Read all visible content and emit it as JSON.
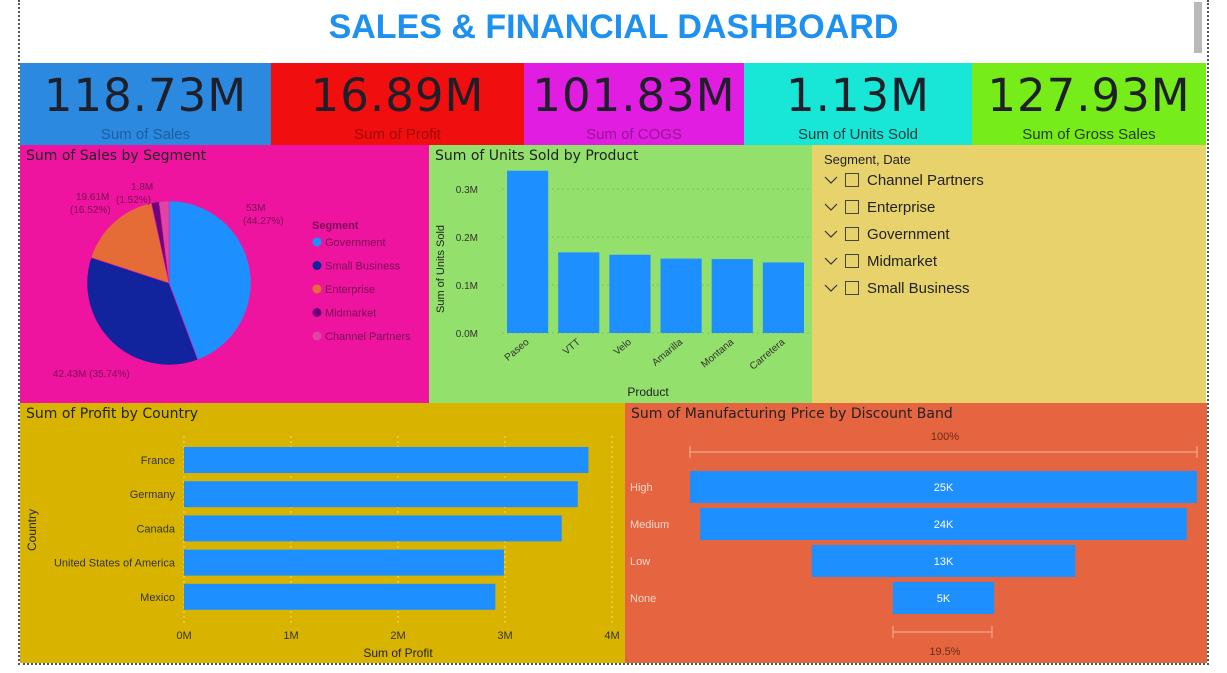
{
  "header": {
    "title": "SALES & FINANCIAL DASHBOARD"
  },
  "colors": {
    "title": "#1e90f0",
    "bar": "#1e8fff",
    "kpi_sales": "#2c89e0",
    "kpi_profit": "#f10e0e",
    "kpi_cogs": "#e01de0",
    "kpi_units": "#18e6d6",
    "kpi_gross": "#76ec18",
    "panel_segment": "#ee14a0",
    "panel_units": "#93e06c",
    "panel_slicer": "#e7d26c",
    "panel_country": "#d8b400",
    "panel_discount": "#e56541"
  },
  "kpis": [
    {
      "value": "118.73M",
      "label": "Sum of  Sales"
    },
    {
      "value": "16.89M",
      "label": "Sum of Profit"
    },
    {
      "value": "101.83M",
      "label": "Sum of COGS"
    },
    {
      "value": "1.13M",
      "label": "Sum of Units Sold"
    },
    {
      "value": "127.93M",
      "label": "Sum of Gross Sales"
    }
  ],
  "segment_chart": {
    "title": "Sum of Sales by Segment",
    "legend_title": "Segment",
    "data_labels": [
      {
        "line1": "53M",
        "line2": "(44.27%)"
      },
      {
        "line1": "42.43M (35.74%)",
        "line2": ""
      },
      {
        "line1": "19.61M",
        "line2": "(16.52%)"
      },
      {
        "line1": "1.8M",
        "line2": "(1.52%)"
      }
    ]
  },
  "units_chart": {
    "title": "Sum of Units Sold by Product",
    "x_title": "Product",
    "y_title": "Sum of Units Sold",
    "y_ticks": [
      "0.0M",
      "0.1M",
      "0.2M",
      "0.3M"
    ]
  },
  "slicer": {
    "header": "Segment, Date",
    "items": [
      {
        "label": "Channel Partners"
      },
      {
        "label": "Enterprise"
      },
      {
        "label": "Government"
      },
      {
        "label": "Midmarket"
      },
      {
        "label": "Small Business"
      }
    ]
  },
  "country_chart": {
    "title": "Sum of Profit by Country",
    "x_title": "Sum of Profit",
    "y_title": "Country",
    "x_ticks": [
      "0M",
      "1M",
      "2M",
      "3M",
      "4M"
    ]
  },
  "discount_chart": {
    "title": "Sum of Manufacturing Price by Discount Band",
    "top_label": "100%",
    "bottom_label": "19.5%"
  },
  "chart_data": [
    {
      "type": "pie",
      "title": "Sum of Sales by Segment",
      "legend_title": "Segment",
      "legend_position": "right",
      "slices": [
        {
          "name": "Government",
          "value": 52.6,
          "percent": 44.27,
          "color": "#1e8fff"
        },
        {
          "name": "Small Business",
          "value": 42.43,
          "percent": 35.74,
          "color": "#12239e"
        },
        {
          "name": "Enterprise",
          "value": 19.61,
          "percent": 16.52,
          "color": "#e66c37"
        },
        {
          "name": "Midmarket",
          "value": 1.8,
          "percent": 1.52,
          "color": "#6b007b"
        },
        {
          "name": "Channel Partners",
          "value": 2.3,
          "percent": 1.95,
          "color": "#e044a7"
        }
      ]
    },
    {
      "type": "bar",
      "title": "Sum of Units Sold by Product",
      "xlabel": "Product",
      "ylabel": "Sum of Units Sold",
      "categories": [
        "Paseo",
        "VTT",
        "Velo",
        "Amarilla",
        "Montana",
        "Carretera"
      ],
      "values": [
        0.338,
        0.168,
        0.163,
        0.155,
        0.154,
        0.147
      ],
      "ylim": [
        0,
        0.35
      ],
      "y_ticks": [
        0,
        0.1,
        0.2,
        0.3
      ]
    },
    {
      "type": "bar",
      "orientation": "horizontal",
      "title": "Sum of Profit by Country",
      "xlabel": "Sum of Profit",
      "ylabel": "Country",
      "categories": [
        "France",
        "Germany",
        "Canada",
        "United States of America",
        "Mexico"
      ],
      "values": [
        3.78,
        3.68,
        3.53,
        2.99,
        2.91
      ],
      "xlim": [
        0,
        4
      ],
      "x_ticks": [
        0,
        1,
        2,
        3,
        4
      ]
    },
    {
      "type": "funnel",
      "title": "Sum of Manufacturing Price by Discount Band",
      "categories": [
        "High",
        "Medium",
        "Low",
        "None"
      ],
      "values": [
        25,
        24,
        13,
        5
      ],
      "value_labels": [
        "25K",
        "24K",
        "13K",
        "5K"
      ]
    }
  ]
}
